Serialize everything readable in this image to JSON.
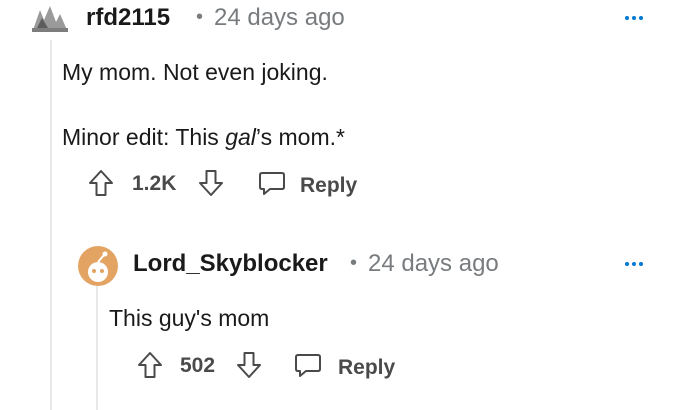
{
  "comment": {
    "username": "rfd2115",
    "separator": "•",
    "timestamp": "24 days ago",
    "body_line1": "My mom. Not even joking.",
    "body_line2_prefix": "Minor edit: This ",
    "body_line2_italic": "gal",
    "body_line2_suffix": "’s mom.*",
    "score": "1.2K",
    "reply_label": "Reply"
  },
  "reply": {
    "username": "Lord_Skyblocker",
    "separator": "•",
    "timestamp": "24 days ago",
    "body": "This guy's mom",
    "score": "502",
    "reply_label": "Reply"
  },
  "colors": {
    "accent": "#0079d3",
    "avatar_orange": "#e3a463",
    "text": "#1a1a1b",
    "muted": "#787c7e"
  }
}
